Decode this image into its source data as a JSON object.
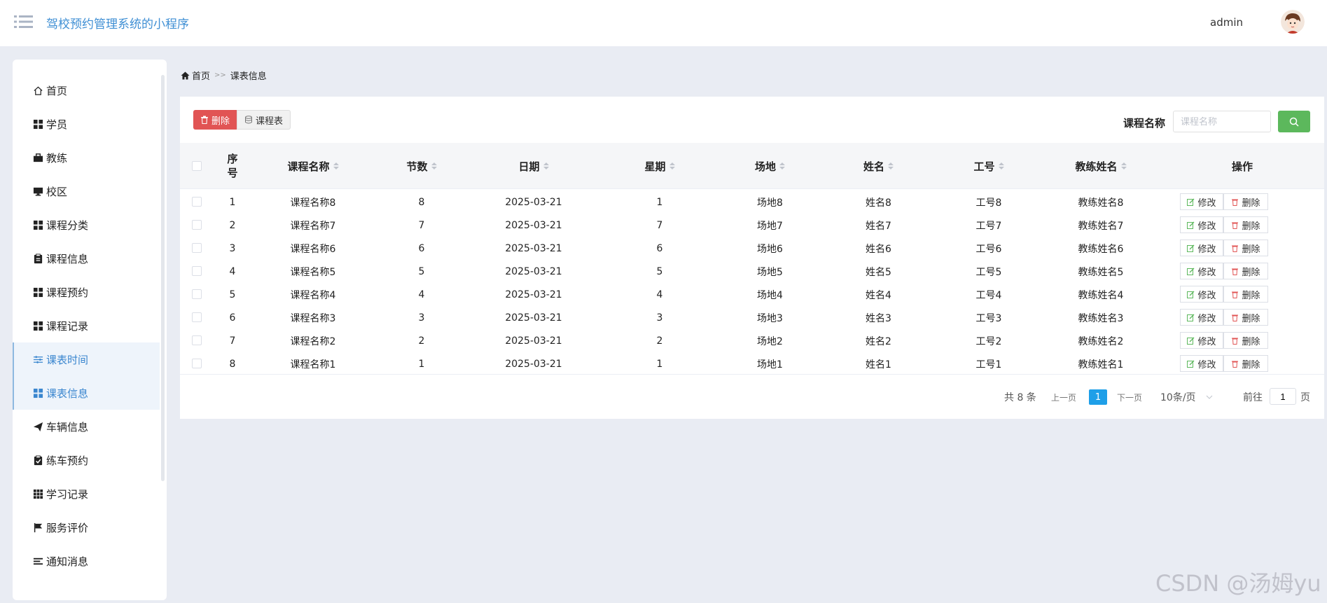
{
  "header": {
    "title": "驾校预约管理系统的小程序",
    "user": "admin"
  },
  "sidebar": {
    "items": [
      {
        "label": "首页",
        "icon": "home-icon"
      },
      {
        "label": "学员",
        "icon": "grid-icon"
      },
      {
        "label": "教练",
        "icon": "briefcase-icon"
      },
      {
        "label": "校区",
        "icon": "desktop-icon"
      },
      {
        "label": "课程分类",
        "icon": "grid-icon"
      },
      {
        "label": "课程信息",
        "icon": "clipboard-icon"
      },
      {
        "label": "课程预约",
        "icon": "grid-icon"
      },
      {
        "label": "课程记录",
        "icon": "grid-icon"
      },
      {
        "label": "课表时间",
        "icon": "sliders-icon"
      },
      {
        "label": "课表信息",
        "icon": "grid-icon"
      },
      {
        "label": "车辆信息",
        "icon": "send-icon"
      },
      {
        "label": "练车预约",
        "icon": "clipboard-check-icon"
      },
      {
        "label": "学习记录",
        "icon": "grid-3x3-icon"
      },
      {
        "label": "服务评价",
        "icon": "flag-icon"
      },
      {
        "label": "通知消息",
        "icon": "list-icon"
      }
    ],
    "active_index": 9
  },
  "breadcrumb": {
    "home": "首页",
    "sep": ">>",
    "current": "课表信息"
  },
  "toolbar": {
    "delete_label": "删除",
    "schedule_label": "课程表",
    "search_label": "课程名称",
    "search_placeholder": "课程名称",
    "search_value": ""
  },
  "table": {
    "headers": [
      "序号",
      "课程名称",
      "节数",
      "日期",
      "星期",
      "场地",
      "姓名",
      "工号",
      "教练姓名",
      "操作"
    ],
    "rows": [
      [
        "1",
        "课程名称8",
        "8",
        "2025-03-21",
        "1",
        "场地8",
        "姓名8",
        "工号8",
        "教练姓名8"
      ],
      [
        "2",
        "课程名称7",
        "7",
        "2025-03-21",
        "7",
        "场地7",
        "姓名7",
        "工号7",
        "教练姓名7"
      ],
      [
        "3",
        "课程名称6",
        "6",
        "2025-03-21",
        "6",
        "场地6",
        "姓名6",
        "工号6",
        "教练姓名6"
      ],
      [
        "4",
        "课程名称5",
        "5",
        "2025-03-21",
        "5",
        "场地5",
        "姓名5",
        "工号5",
        "教练姓名5"
      ],
      [
        "5",
        "课程名称4",
        "4",
        "2025-03-21",
        "4",
        "场地4",
        "姓名4",
        "工号4",
        "教练姓名4"
      ],
      [
        "6",
        "课程名称3",
        "3",
        "2025-03-21",
        "3",
        "场地3",
        "姓名3",
        "工号3",
        "教练姓名3"
      ],
      [
        "7",
        "课程名称2",
        "2",
        "2025-03-21",
        "2",
        "场地2",
        "姓名2",
        "工号2",
        "教练姓名2"
      ],
      [
        "8",
        "课程名称1",
        "1",
        "2025-03-21",
        "1",
        "场地1",
        "姓名1",
        "工号1",
        "教练姓名1"
      ]
    ],
    "edit_label": "修改",
    "delete_label": "删除"
  },
  "pagination": {
    "total": "共 8 条",
    "prev": "上一页",
    "current": "1",
    "next": "下一页",
    "page_size": "10条/页",
    "goto": "前往",
    "goto_value": "1",
    "unit": "页"
  },
  "watermark": "CSDN @汤姆yu",
  "colors": {
    "accent": "#1e9fe8",
    "danger": "#e15454",
    "success": "#5cb85c",
    "title": "#3f8fd4"
  }
}
